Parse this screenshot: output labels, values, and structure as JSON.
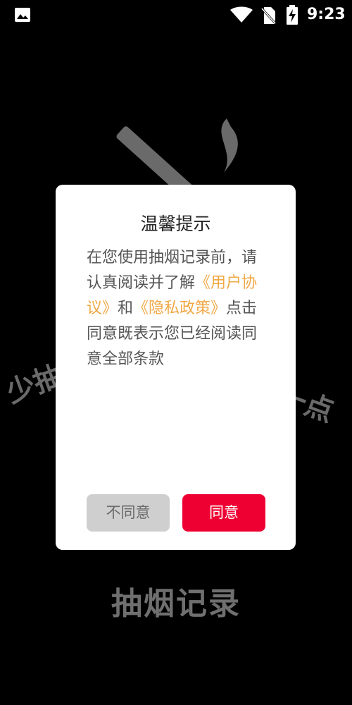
{
  "status_bar": {
    "time": "9:23",
    "icons": [
      "picture-icon",
      "wifi-icon",
      "no-sim-icon",
      "battery-charging-icon"
    ]
  },
  "background": {
    "left_text": "少抽",
    "right_text": "一点",
    "app_title": "抽烟记录",
    "art_color": "#6a6a6a"
  },
  "dialog": {
    "title": "温馨提示",
    "body_prefix": "在您使用抽烟记录前，请认真阅读并了解",
    "user_agreement_link": "《用户协议》",
    "conjunction": "和",
    "privacy_policy_link": "《隐私政策》",
    "body_suffix": "点击同意既表示您已经阅读同意全部条款",
    "disagree_label": "不同意",
    "agree_label": "同意",
    "colors": {
      "link": "#f0a846",
      "agree_button": "#ee0033",
      "disagree_button": "#cfcfcf"
    }
  }
}
